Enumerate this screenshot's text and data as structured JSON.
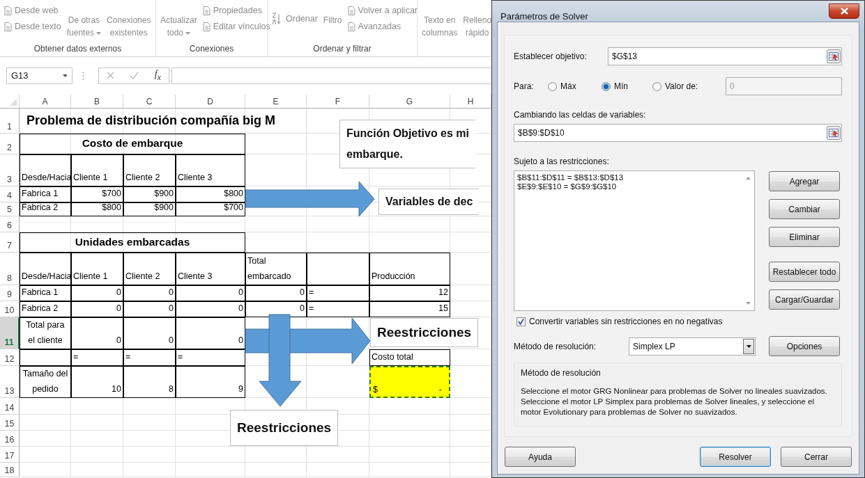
{
  "ribbon": {
    "disabled": true,
    "groups": [
      {
        "label": "Obtener datos externos",
        "items": [
          {
            "kind": "small",
            "label": "Desde web"
          },
          {
            "kind": "small",
            "label": "Desde texto"
          },
          {
            "kind": "large",
            "label": "De otras\nfuentes",
            "dropdown": true
          },
          {
            "kind": "large",
            "label": "Conexiones\nexistentes"
          }
        ]
      },
      {
        "label": "Conexiones",
        "items": [
          {
            "kind": "large",
            "label": "Actualizar\ntodo",
            "dropdown": true
          },
          {
            "kind": "small",
            "label": "Propiedades"
          },
          {
            "kind": "small",
            "label": "Editar vínculos"
          }
        ]
      },
      {
        "label": "Ordenar y filtrar",
        "items": [
          {
            "kind": "sort",
            "label": "Ordenar"
          },
          {
            "kind": "large",
            "label": "Filtro"
          },
          {
            "kind": "small",
            "label": "Volver a aplicar"
          },
          {
            "kind": "small",
            "label": "Avanzadas"
          }
        ]
      },
      {
        "items": [
          {
            "kind": "large",
            "label": "Texto en\ncolumnas"
          },
          {
            "kind": "large",
            "label": "Relleno\nrápido"
          }
        ]
      }
    ]
  },
  "formula_bar": {
    "name_box": "G13",
    "function_label": "f$_{x}$"
  },
  "sheet": {
    "columns": [
      "A",
      "B",
      "C",
      "D",
      "E",
      "F",
      "G",
      "H"
    ],
    "rows": [
      {
        "number": "1",
        "selected": false,
        "cells": [
          {
            "kind": "title",
            "text": "Problema de distribución compañía big M"
          }
        ]
      },
      {
        "number": "2",
        "selected": false,
        "cells": [
          {
            "kind": "section",
            "boxed": true,
            "text": "Costo de embarque"
          }
        ]
      },
      {
        "number": "3",
        "selected": false,
        "cells": [
          {
            "kind": "label",
            "boxed": true,
            "text": "Desde/Hacia"
          },
          {
            "kind": "label",
            "boxed": true,
            "text": "Cliente 1"
          },
          {
            "kind": "label",
            "boxed": true,
            "text": "Cliente 2"
          },
          {
            "kind": "label",
            "boxed": true,
            "text": "Cliente 3"
          }
        ]
      },
      {
        "number": "4",
        "selected": false,
        "cells": [
          {
            "kind": "label",
            "boxed": true,
            "text": "Fabrica 1"
          },
          {
            "kind": "number",
            "boxed": true,
            "text": "$700"
          },
          {
            "kind": "number",
            "boxed": true,
            "text": "$900"
          },
          {
            "kind": "number",
            "boxed": true,
            "text": "$800"
          }
        ]
      },
      {
        "number": "5",
        "selected": false,
        "cells": [
          {
            "kind": "label",
            "boxed": true,
            "text": "Fabrica 2"
          },
          {
            "kind": "number",
            "boxed": true,
            "text": "$800"
          },
          {
            "kind": "number",
            "boxed": true,
            "text": "$900"
          },
          {
            "kind": "number",
            "boxed": true,
            "text": "$700"
          }
        ]
      },
      {
        "number": "6",
        "selected": false,
        "cells": []
      },
      {
        "number": "7",
        "selected": false,
        "cells": [
          {
            "kind": "section",
            "boxed": true,
            "text": "Unidades embarcadas"
          }
        ]
      },
      {
        "number": "8",
        "selected": false,
        "cells": [
          {
            "kind": "label",
            "boxed": true,
            "text": "Desde/Hacia"
          },
          {
            "kind": "label",
            "boxed": true,
            "text": "Cliente 1"
          },
          {
            "kind": "label",
            "boxed": true,
            "text": "Cliente 2"
          },
          {
            "kind": "label",
            "boxed": true,
            "text": "Cliente 3"
          },
          {
            "kind": "label",
            "boxed": true,
            "text": "Total embarcado"
          },
          {
            "kind": "blank",
            "boxed": true
          },
          {
            "kind": "label",
            "boxed": true,
            "text": "Producción"
          }
        ]
      },
      {
        "number": "9",
        "selected": false,
        "cells": [
          {
            "kind": "label",
            "boxed": true,
            "text": "Fabrica 1"
          },
          {
            "kind": "number",
            "boxed": true,
            "text": "0"
          },
          {
            "kind": "number",
            "boxed": true,
            "text": "0"
          },
          {
            "kind": "number",
            "boxed": true,
            "text": "0"
          },
          {
            "kind": "number",
            "boxed": true,
            "text": "0"
          },
          {
            "kind": "label",
            "boxed": true,
            "text": "="
          },
          {
            "kind": "number",
            "boxed": true,
            "text": "12"
          }
        ]
      },
      {
        "number": "10",
        "selected": false,
        "cells": [
          {
            "kind": "label",
            "boxed": true,
            "text": "Fabrica 2"
          },
          {
            "kind": "number",
            "boxed": true,
            "text": "0"
          },
          {
            "kind": "number",
            "boxed": true,
            "text": "0"
          },
          {
            "kind": "number",
            "boxed": true,
            "text": "0"
          },
          {
            "kind": "number",
            "boxed": true,
            "text": "0"
          },
          {
            "kind": "label",
            "boxed": true,
            "text": "="
          },
          {
            "kind": "number",
            "boxed": true,
            "text": "15"
          }
        ]
      },
      {
        "number": "11",
        "selected": true,
        "cells": [
          {
            "kind": "center",
            "boxed": true,
            "text": "Total para el cliente"
          },
          {
            "kind": "number",
            "boxed": true,
            "text": "0"
          },
          {
            "kind": "number",
            "boxed": true,
            "text": "0"
          },
          {
            "kind": "number",
            "boxed": true,
            "text": "0"
          }
        ]
      },
      {
        "number": "12",
        "selected": false,
        "cells": [
          {
            "kind": "blank",
            "boxed": true
          },
          {
            "kind": "label",
            "boxed": true,
            "text": "="
          },
          {
            "kind": "label",
            "boxed": true,
            "text": "="
          },
          {
            "kind": "label",
            "boxed": true,
            "text": "="
          },
          {
            "kind": "label",
            "boxed": true,
            "text": "Costo total"
          }
        ]
      },
      {
        "number": "13",
        "selected": false,
        "cells": [
          {
            "kind": "center",
            "boxed": true,
            "text": "Tamaño del pedido"
          },
          {
            "kind": "number",
            "boxed": true,
            "text": "10"
          },
          {
            "kind": "number",
            "boxed": true,
            "text": "8"
          },
          {
            "kind": "number",
            "boxed": true,
            "text": "9"
          },
          {
            "kind": "total",
            "symbol": "$",
            "text": "-"
          }
        ]
      },
      {
        "number": "14",
        "selected": false,
        "cells": []
      },
      {
        "number": "15",
        "selected": false,
        "cells": []
      },
      {
        "number": "16",
        "selected": false,
        "cells": []
      },
      {
        "number": "17",
        "selected": false,
        "cells": []
      },
      {
        "number": "18",
        "selected": false,
        "cells": []
      }
    ],
    "text_boxes": [
      {
        "text": "Función Objetivo es mi\nembarque."
      },
      {
        "text": "Variables de dec"
      },
      {
        "text": "Reestricciones"
      },
      {
        "text": "Reestricciones"
      }
    ]
  },
  "dialog": {
    "title": "Parámetros de Solver",
    "objective": {
      "label": "Establecer objetivo:",
      "value": "$G$13"
    },
    "goal": {
      "label": "Para:",
      "options": [
        {
          "label": "Máx",
          "selected": false
        },
        {
          "label": "Mín",
          "selected": true
        },
        {
          "label": "Valor de:",
          "selected": false
        }
      ],
      "value": "0",
      "disabled": true
    },
    "variables": {
      "label": "Cambiando las celdas de variables:",
      "value": "$B$9:$D$10"
    },
    "constraints": {
      "label": "Sujeto a las restricciones:",
      "items": [
        "$B$11:$D$11 = $B$13:$D$13",
        "$E$9:$E$10 = $G$9:$G$10"
      ]
    },
    "side_buttons": [
      "Agregar",
      "Cambiar",
      "Eliminar",
      "Restablecer todo",
      "Cargar/Guardar"
    ],
    "nonnegative": {
      "label": "Convertir variables sin restricciones en no negativas",
      "checked": true
    },
    "method": {
      "label": "Método de resolución:",
      "value": "Simplex LP",
      "button": "Opciones"
    },
    "description": {
      "title": "Método de resolución",
      "text": "Seleccione el motor GRG Nonlinear para problemas de Solver no lineales suavizados. Seleccione el motor LP Simplex para problemas de Solver lineales, y seleccione el motor Evolutionary para problemas de Solver no suavizados."
    },
    "footer_buttons": [
      {
        "label": "Ayuda",
        "default": false
      },
      {
        "label": "Resolver",
        "default": true
      },
      {
        "label": "Cerrar",
        "default": false
      }
    ]
  }
}
